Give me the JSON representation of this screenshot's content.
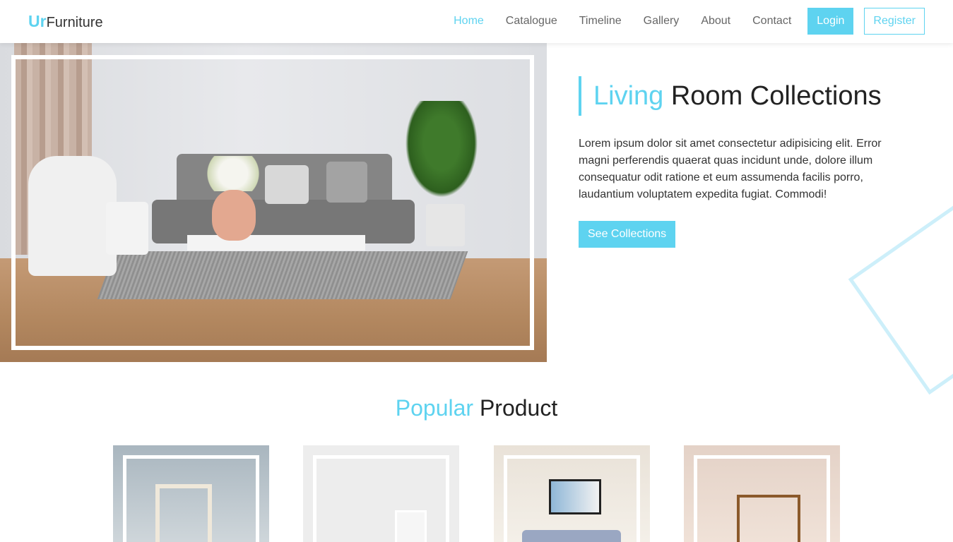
{
  "brand": {
    "accent": "Ur",
    "rest": "Furniture"
  },
  "nav": {
    "links": [
      "Home",
      "Catalogue",
      "Timeline",
      "Gallery",
      "About",
      "Contact"
    ],
    "active": "Home",
    "login": "Login",
    "register": "Register"
  },
  "hero": {
    "title_accent": "Living",
    "title_rest": " Room Collections",
    "description": "Lorem ipsum dolor sit amet consectetur adipisicing elit. Error magni perferendis quaerat quas incidunt unde, dolore illum consequatur odit ratione et eum assumenda facilis porro, laudantium voluptatem expedita fugiat. Commodi!",
    "button": "See Collections"
  },
  "popular": {
    "title_accent": "Popular",
    "title_rest": " Product"
  },
  "colors": {
    "accent": "#5ed3f0",
    "deco": "#cdeffa"
  }
}
